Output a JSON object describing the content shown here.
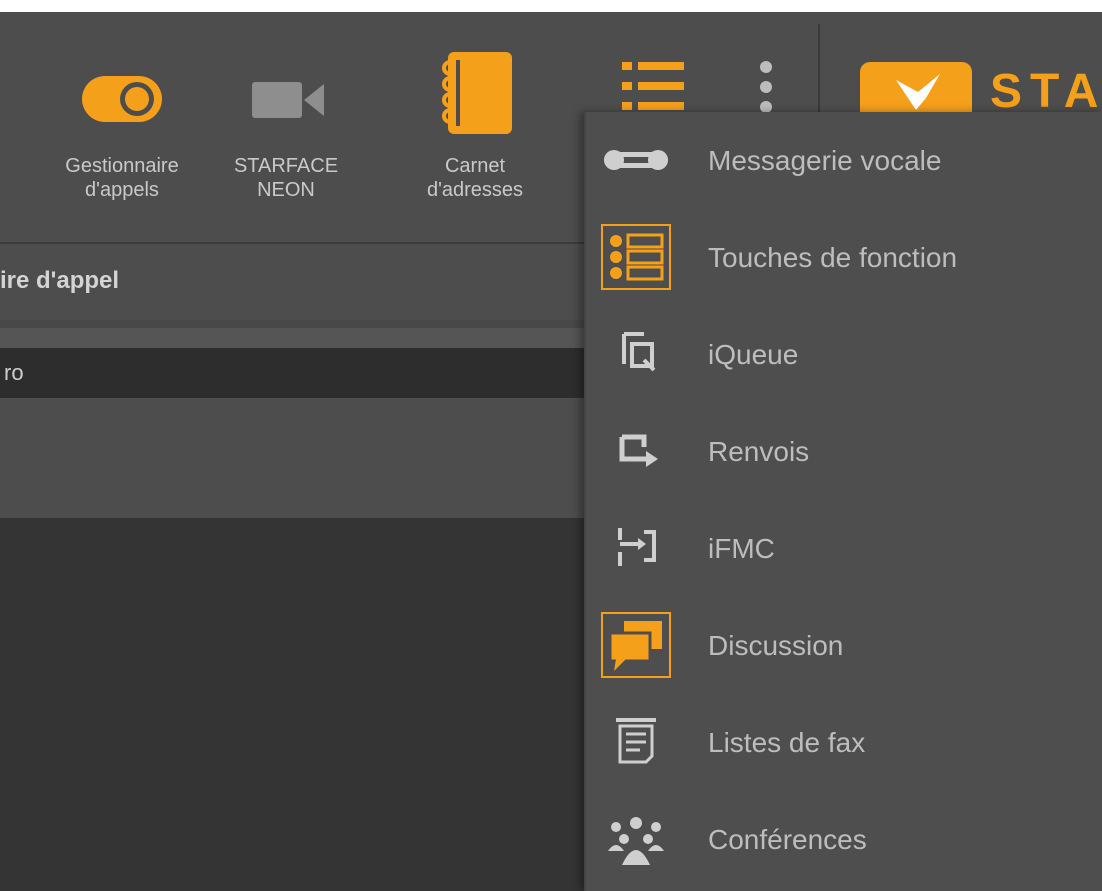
{
  "toolbar": {
    "buttons": [
      {
        "label": "Gestionnaire\nd'appels",
        "icon": "toggle-icon"
      },
      {
        "label": "STARFACE\nNEON",
        "icon": "video-camera-icon"
      },
      {
        "label": "Carnet\nd'adresses",
        "icon": "address-book-icon"
      }
    ],
    "list_icon": "list-icon",
    "more_icon": "more-vertical-icon"
  },
  "brand": {
    "text": "STA",
    "icon": "starface-logo-icon"
  },
  "panel": {
    "title": "ire d'appel",
    "search_value": "ro"
  },
  "menu": {
    "items": [
      {
        "label": "Messagerie vocale",
        "icon": "voicemail-icon"
      },
      {
        "label": "Touches de fonction",
        "icon": "function-keys-icon"
      },
      {
        "label": "iQueue",
        "icon": "iqueue-icon"
      },
      {
        "label": "Renvois",
        "icon": "redirect-icon"
      },
      {
        "label": "iFMC",
        "icon": "ifmc-icon"
      },
      {
        "label": "Discussion",
        "icon": "chat-icon"
      },
      {
        "label": "Listes de fax",
        "icon": "fax-list-icon"
      },
      {
        "label": "Conférences",
        "icon": "conference-icon"
      }
    ]
  },
  "colors": {
    "accent": "#f4a01b",
    "background": "#4d4d4d",
    "text": "#bdbdbd"
  }
}
